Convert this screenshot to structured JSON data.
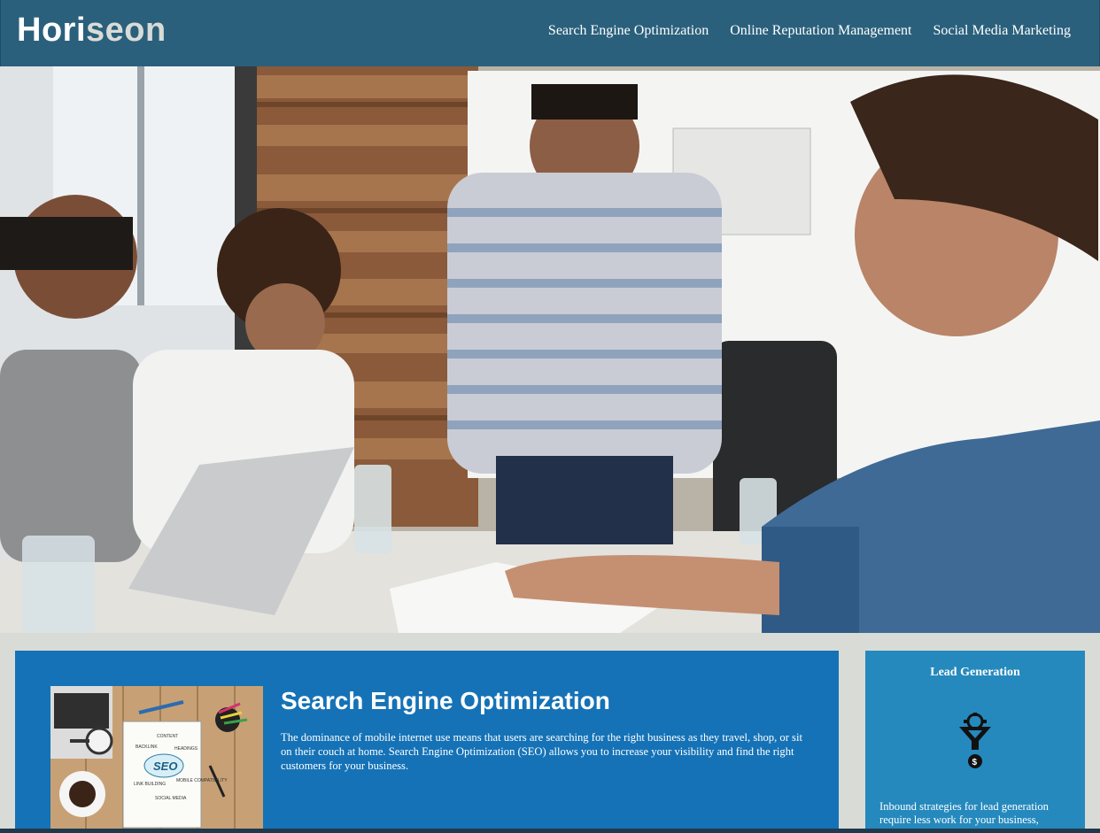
{
  "header": {
    "logo_part1": "Hori",
    "logo_part2": "seon",
    "nav": [
      {
        "label": "Search Engine Optimization"
      },
      {
        "label": "Online Reputation Management"
      },
      {
        "label": "Social Media Marketing"
      }
    ]
  },
  "hero": {
    "image": "team-meeting-photo"
  },
  "seo": {
    "title": "Search Engine Optimization",
    "text": "The dominance of mobile internet use means that users are searching for the right business as they travel, shop, or sit on their couch at home. Search Engine Optimization (SEO) allows you to increase your visibility and find the right customers for your business.",
    "image_words": {
      "seo": "SEO",
      "content": "CONTENT",
      "backlink": "BACKLINK",
      "headings": "HEADINGS",
      "link_building": "LINK BUILDING",
      "mobile": "MOBILE COMPATIBILITY",
      "social": "SOCIAL MEDIA"
    }
  },
  "sidebar": {
    "lead_title": "Lead Generation",
    "lead_icon": "lead-funnel-icon",
    "lead_text": "Inbound strategies for lead generation require less work for your business,"
  },
  "colors": {
    "header": "#2a607c",
    "page_bg": "#d9dcd6",
    "seo_card": "#1572b6",
    "lead_card": "#2589bd"
  }
}
